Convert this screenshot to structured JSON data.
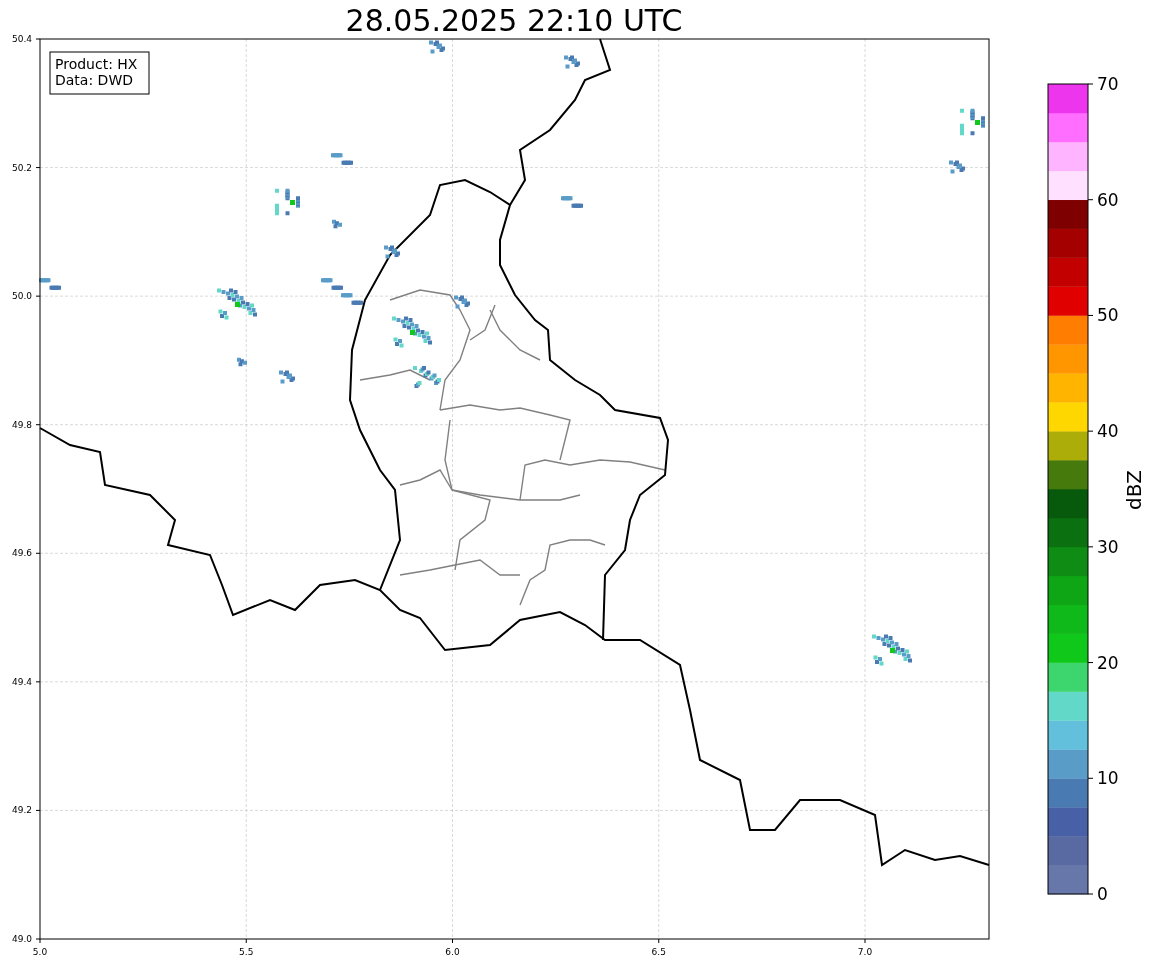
{
  "title": "28.05.2025 22:10 UTC",
  "info_box": [
    "Product: HX",
    "Data: DWD"
  ],
  "x_ticks": [
    "5.0",
    "5.5",
    "6.0",
    "6.5",
    "7.0"
  ],
  "y_ticks": [
    "50.4",
    "50.2",
    "50.0",
    "49.8",
    "49.6",
    "49.4",
    "49.2",
    "49.0"
  ],
  "colorbar": {
    "label": "dBZ",
    "ticks": [
      "70",
      "60",
      "50",
      "40",
      "30",
      "20",
      "10",
      "0"
    ],
    "bins": [
      {
        "color": "#6777a9"
      },
      {
        "color": "#586aa1"
      },
      {
        "color": "#4861a6"
      },
      {
        "color": "#4a7ab2"
      },
      {
        "color": "#5a9cc8"
      },
      {
        "color": "#62c0dc"
      },
      {
        "color": "#62d8c8"
      },
      {
        "color": "#3dd66e"
      },
      {
        "color": "#10c81a"
      },
      {
        "color": "#10b91a"
      },
      {
        "color": "#0ea614"
      },
      {
        "color": "#0e8c14"
      },
      {
        "color": "#0a7010"
      },
      {
        "color": "#075a0b"
      },
      {
        "color": "#467a0c"
      },
      {
        "color": "#adad0a"
      },
      {
        "color": "#ffd700"
      },
      {
        "color": "#ffb400"
      },
      {
        "color": "#ff9600"
      },
      {
        "color": "#ff7d00"
      },
      {
        "color": "#e10000"
      },
      {
        "color": "#c30000"
      },
      {
        "color": "#a50000"
      },
      {
        "color": "#7f0000"
      },
      {
        "color": "#ffe0ff"
      },
      {
        "color": "#ffb4ff"
      },
      {
        "color": "#ff6eff"
      },
      {
        "color": "#ee35ee"
      }
    ]
  }
}
